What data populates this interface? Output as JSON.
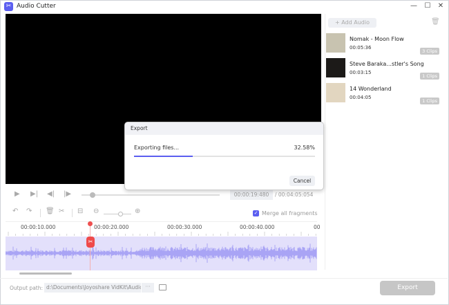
{
  "window": {
    "title": "Audio Cutter",
    "minimize": "—",
    "maximize": "☐",
    "close": "✕"
  },
  "sidebar": {
    "add_audio": "+ Add Audio",
    "items": [
      {
        "name": "Nomak - Moon Flow",
        "duration": "00:05:36",
        "clips": "3 Clips",
        "thumb_color": "#c8c3b0"
      },
      {
        "name": "Steve Baraka...stler's Song",
        "duration": "00:03:15",
        "clips": "1 Clips",
        "thumb_color": "#1c1a18"
      },
      {
        "name": "14 Wonderland",
        "duration": "00:04:05",
        "clips": "1 Clips",
        "thumb_color": "#e2d6c0"
      }
    ]
  },
  "player": {
    "current_time": "00:00:19:480",
    "total_time": "/ 00:04:05:054",
    "seek_progress": 0.06
  },
  "toolbar": {
    "merge_label": "Merge all fragments",
    "merge_checked": true
  },
  "timeline": {
    "ticks": [
      "00:00:10.000",
      "00:00:20.000",
      "00:00:30.000",
      "00:00:40.000",
      "00"
    ],
    "playhead_time": "00:00:19.480"
  },
  "footer": {
    "output_label": "Output path:",
    "output_path": "d:\\Documents\\Joyoshare VidKit\\Audio",
    "browse": "···",
    "export_label": "Export"
  },
  "dialog": {
    "title": "Export",
    "message": "Exporting files...",
    "percent_text": "32.58%",
    "progress": 0.3258,
    "cancel_label": "Cancel"
  },
  "colors": {
    "accent": "#5b5ef0",
    "waveform": "#a9a4f5",
    "waveform_bg": "#e3e0fb",
    "playhead": "#ef4a4a"
  }
}
